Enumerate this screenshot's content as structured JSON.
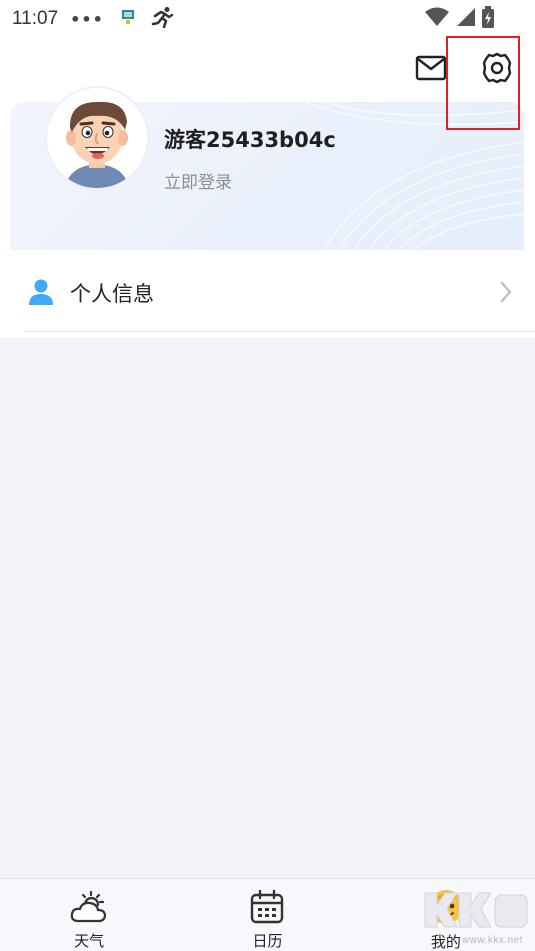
{
  "status_bar": {
    "time": "11:07",
    "dots": "•••"
  },
  "profile": {
    "username": "游客25433b04c",
    "login_link": "立即登录"
  },
  "menu": {
    "items": [
      {
        "label": "个人信息",
        "icon": "person-icon"
      }
    ]
  },
  "bottom_nav": {
    "items": [
      {
        "label": "天气",
        "icon": "cloud-sun-icon"
      },
      {
        "label": "日历",
        "icon": "calendar-icon"
      },
      {
        "label": "我的",
        "icon": "avatar-face-icon"
      }
    ]
  },
  "watermark": {
    "text": "www.kkx.net"
  },
  "colors": {
    "accent_blue": "#3fa9f5",
    "highlight_red": "#e0201f",
    "background": "#f2f3f8"
  }
}
